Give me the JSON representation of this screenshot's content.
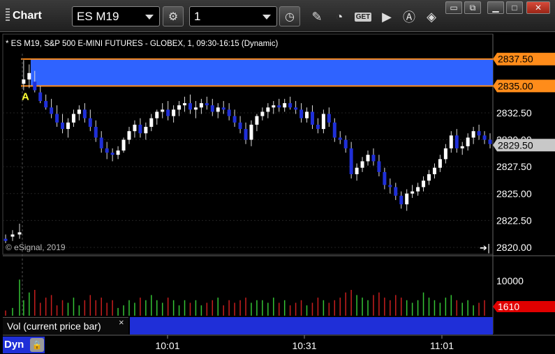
{
  "toolbar": {
    "title": "Chart",
    "symbol": "ES M19",
    "interval": "1",
    "get_label": "GET"
  },
  "legend": {
    "title": "* ES M19, S&P 500 E-MINI FUTURES - GLOBEX, 1, 09:30-16:15 (Dynamic)"
  },
  "copyright": "© eSignal, 2019",
  "annotation_label": "A",
  "volume_panel": {
    "label": "Vol (current price bar)",
    "close_glyph": "×",
    "current_value": "1610",
    "axis_tick": "10000"
  },
  "footer": {
    "dyn_label": "Dyn"
  },
  "colors": {
    "up_candle": "#ffffff",
    "down_candle": "#1f2fd8",
    "highlight_zone": "#2f63ff",
    "zone_border": "#ff8c1a",
    "price_tag": "#ff8c1a",
    "last_price_tag": "#c8c8c8",
    "volume_tag": "#e00000",
    "volume_up": "#35c435",
    "volume_down": "#c81e1e"
  },
  "chart_data": {
    "type": "candlestick",
    "y_ticks": [
      "2820.00",
      "2822.50",
      "2825.00",
      "2827.50",
      "2830.00",
      "2832.50"
    ],
    "x_ticks": [
      "10:01",
      "10:31",
      "11:01"
    ],
    "price_tags": [
      {
        "label": "2837.50",
        "value": 2837.5,
        "kind": "zone"
      },
      {
        "label": "2835.00",
        "value": 2835.0,
        "kind": "zone"
      },
      {
        "label": "2829.50",
        "value": 2829.5,
        "kind": "last"
      }
    ],
    "zone": {
      "low": 2835.0,
      "high": 2837.5
    },
    "ylim": [
      2820,
      2838
    ],
    "candles": [
      [
        2820.8,
        2821.2,
        2820.4,
        2820.6
      ],
      [
        2821.0,
        2821.6,
        2820.6,
        2821.2
      ],
      [
        2821.2,
        2822.2,
        2820.8,
        2821.4
      ],
      [
        2835.2,
        2837.4,
        2834.6,
        2835.6
      ],
      [
        2835.6,
        2837.0,
        2834.8,
        2836.2
      ],
      [
        2835.4,
        2836.4,
        2834.4,
        2834.6
      ],
      [
        2834.4,
        2835.0,
        2833.4,
        2833.6
      ],
      [
        2833.6,
        2834.2,
        2832.8,
        2833.0
      ],
      [
        2833.0,
        2833.8,
        2832.0,
        2832.4
      ],
      [
        2832.4,
        2833.2,
        2831.2,
        2831.6
      ],
      [
        2831.6,
        2832.4,
        2830.6,
        2831.0
      ],
      [
        2831.0,
        2832.0,
        2830.2,
        2831.6
      ],
      [
        2831.6,
        2832.8,
        2831.2,
        2832.4
      ],
      [
        2832.4,
        2833.2,
        2831.8,
        2832.8
      ],
      [
        2832.8,
        2833.4,
        2831.6,
        2832.0
      ],
      [
        2832.0,
        2832.8,
        2830.8,
        2831.2
      ],
      [
        2831.2,
        2831.8,
        2829.8,
        2830.2
      ],
      [
        2830.2,
        2830.8,
        2828.8,
        2829.2
      ],
      [
        2829.2,
        2829.8,
        2828.2,
        2828.8
      ],
      [
        2828.8,
        2829.2,
        2828.0,
        2828.6
      ],
      [
        2828.6,
        2829.4,
        2828.2,
        2829.0
      ],
      [
        2829.0,
        2830.2,
        2828.8,
        2830.0
      ],
      [
        2830.0,
        2831.2,
        2829.6,
        2830.8
      ],
      [
        2830.8,
        2831.8,
        2830.2,
        2831.4
      ],
      [
        2831.4,
        2832.0,
        2830.2,
        2830.6
      ],
      [
        2830.6,
        2831.6,
        2830.0,
        2831.2
      ],
      [
        2831.2,
        2832.4,
        2830.8,
        2832.0
      ],
      [
        2832.0,
        2832.8,
        2831.4,
        2832.6
      ],
      [
        2832.6,
        2833.4,
        2832.0,
        2832.8
      ],
      [
        2832.8,
        2833.6,
        2831.8,
        2832.2
      ],
      [
        2832.2,
        2833.2,
        2831.6,
        2832.8
      ],
      [
        2832.8,
        2833.6,
        2832.2,
        2833.2
      ],
      [
        2833.2,
        2834.0,
        2832.6,
        2833.4
      ],
      [
        2833.4,
        2834.2,
        2832.4,
        2832.8
      ],
      [
        2832.8,
        2833.6,
        2832.0,
        2833.0
      ],
      [
        2833.0,
        2833.8,
        2832.4,
        2833.4
      ],
      [
        2833.4,
        2834.0,
        2832.8,
        2833.2
      ],
      [
        2833.2,
        2833.8,
        2832.2,
        2832.6
      ],
      [
        2832.6,
        2833.4,
        2832.0,
        2833.0
      ],
      [
        2833.0,
        2833.6,
        2832.4,
        2832.8
      ],
      [
        2832.8,
        2833.4,
        2831.8,
        2832.2
      ],
      [
        2832.2,
        2832.8,
        2831.2,
        2831.6
      ],
      [
        2831.6,
        2832.2,
        2830.6,
        2831.0
      ],
      [
        2831.0,
        2831.6,
        2829.6,
        2830.0
      ],
      [
        2830.0,
        2831.8,
        2829.4,
        2831.4
      ],
      [
        2831.4,
        2832.4,
        2830.8,
        2832.2
      ],
      [
        2832.2,
        2833.0,
        2831.8,
        2832.6
      ],
      [
        2832.6,
        2833.4,
        2832.0,
        2833.0
      ],
      [
        2833.0,
        2833.6,
        2832.4,
        2833.2
      ],
      [
        2833.2,
        2833.8,
        2832.6,
        2833.0
      ],
      [
        2833.0,
        2833.8,
        2832.6,
        2833.4
      ],
      [
        2833.4,
        2834.0,
        2832.8,
        2833.0
      ],
      [
        2833.0,
        2833.6,
        2832.4,
        2832.8
      ],
      [
        2832.8,
        2833.4,
        2831.6,
        2832.0
      ],
      [
        2832.0,
        2833.0,
        2831.6,
        2832.6
      ],
      [
        2832.6,
        2833.2,
        2831.0,
        2831.4
      ],
      [
        2831.4,
        2832.0,
        2830.6,
        2831.0
      ],
      [
        2831.0,
        2832.8,
        2830.6,
        2832.4
      ],
      [
        2832.4,
        2833.0,
        2831.2,
        2831.6
      ],
      [
        2831.6,
        2832.0,
        2829.8,
        2830.2
      ],
      [
        2830.2,
        2830.8,
        2829.6,
        2830.0
      ],
      [
        2830.0,
        2830.4,
        2828.8,
        2829.2
      ],
      [
        2829.2,
        2829.8,
        2826.4,
        2826.8
      ],
      [
        2826.8,
        2827.8,
        2826.2,
        2827.4
      ],
      [
        2827.4,
        2828.4,
        2827.0,
        2828.0
      ],
      [
        2828.0,
        2829.0,
        2827.6,
        2828.6
      ],
      [
        2828.6,
        2829.2,
        2827.6,
        2828.0
      ],
      [
        2828.0,
        2828.6,
        2826.6,
        2827.0
      ],
      [
        2827.0,
        2827.4,
        2825.4,
        2825.8
      ],
      [
        2825.8,
        2826.4,
        2825.0,
        2825.6
      ],
      [
        2825.6,
        2826.0,
        2824.4,
        2824.8
      ],
      [
        2824.8,
        2825.2,
        2823.6,
        2824.0
      ],
      [
        2824.0,
        2825.4,
        2823.4,
        2825.0
      ],
      [
        2825.0,
        2825.8,
        2824.6,
        2825.2
      ],
      [
        2825.2,
        2826.0,
        2824.8,
        2825.6
      ],
      [
        2825.6,
        2826.6,
        2825.2,
        2826.2
      ],
      [
        2826.2,
        2827.2,
        2825.8,
        2826.8
      ],
      [
        2826.8,
        2827.8,
        2826.4,
        2827.4
      ],
      [
        2827.4,
        2828.6,
        2827.0,
        2828.2
      ],
      [
        2828.2,
        2829.6,
        2827.8,
        2829.2
      ],
      [
        2829.2,
        2830.8,
        2828.8,
        2830.4
      ],
      [
        2830.4,
        2831.0,
        2828.8,
        2829.2
      ],
      [
        2829.2,
        2829.8,
        2828.6,
        2829.4
      ],
      [
        2829.4,
        2830.6,
        2829.0,
        2830.2
      ],
      [
        2830.2,
        2831.2,
        2829.6,
        2830.8
      ],
      [
        2830.8,
        2831.4,
        2830.0,
        2830.4
      ],
      [
        2830.4,
        2830.8,
        2829.6,
        2830.0
      ],
      [
        2830.0,
        2830.6,
        2829.2,
        2829.6
      ]
    ],
    "volumes": [
      0.1,
      0.15,
      0.7,
      0.3,
      0.45,
      0.5,
      0.25,
      0.35,
      0.4,
      0.2,
      0.3,
      0.25,
      0.35,
      0.2,
      0.3,
      0.4,
      0.3,
      0.35,
      0.25,
      0.3,
      0.15,
      0.2,
      0.3,
      0.25,
      0.35,
      0.3,
      0.4,
      0.3,
      0.25,
      0.35,
      0.3,
      0.2,
      0.3,
      0.25,
      0.3,
      0.2,
      0.25,
      0.3,
      0.35,
      0.2,
      0.3,
      0.25,
      0.3,
      0.35,
      0.25,
      0.3,
      0.3,
      0.25,
      0.35,
      0.25,
      0.3,
      0.2,
      0.25,
      0.3,
      0.2,
      0.25,
      0.35,
      0.3,
      0.25,
      0.3,
      0.35,
      0.45,
      0.5,
      0.4,
      0.35,
      0.3,
      0.4,
      0.45,
      0.35,
      0.3,
      0.4,
      0.35,
      0.3,
      0.25,
      0.3,
      0.45,
      0.35,
      0.3,
      0.25,
      0.35,
      0.4,
      0.3,
      0.25,
      0.3,
      0.2,
      0.25,
      0.3
    ]
  }
}
